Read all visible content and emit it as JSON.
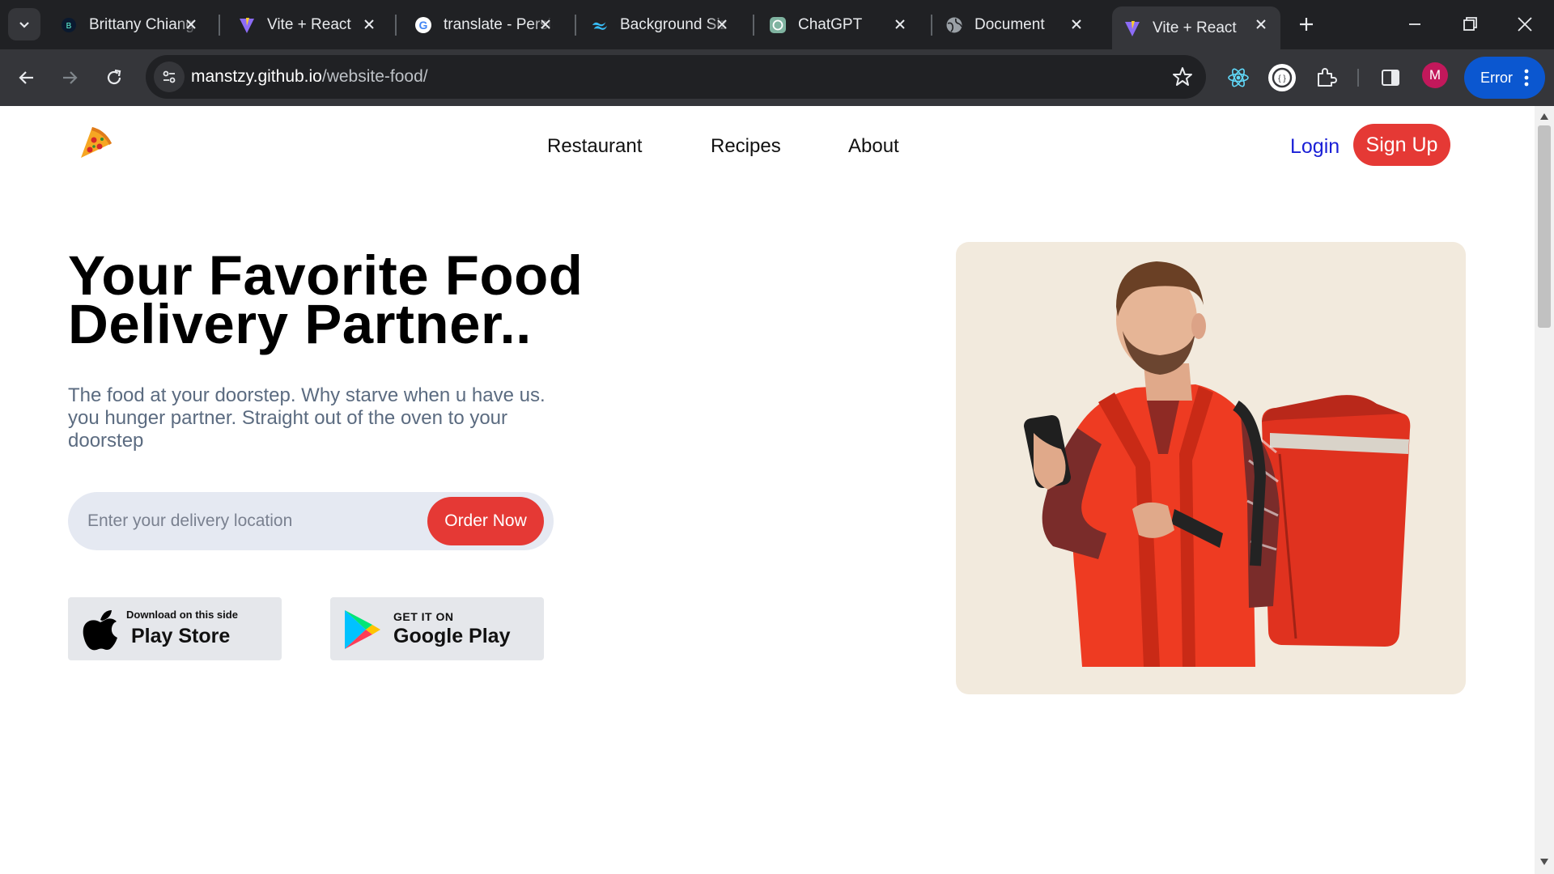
{
  "browser": {
    "tabs": [
      {
        "label": "Brittany Chiang",
        "icon": "b-favicon"
      },
      {
        "label": "Vite + React",
        "icon": "vite-icon"
      },
      {
        "label": "translate - Persian",
        "icon": "google-icon"
      },
      {
        "label": "Background Size",
        "icon": "tailwind-icon"
      },
      {
        "label": "ChatGPT",
        "icon": "chatgpt-icon"
      },
      {
        "label": "Document",
        "icon": "globe-icon"
      },
      {
        "label": "Vite + React",
        "icon": "vite-icon",
        "active": true
      }
    ],
    "url_host": "manstzy.github.io",
    "url_path": "/website-food/",
    "profile_initial": "M",
    "error_label": "Error"
  },
  "page": {
    "nav": {
      "links": [
        "Restaurant",
        "Recipes",
        "About"
      ],
      "login": "Login",
      "signup": "Sign Up"
    },
    "hero": {
      "headline_line1": "Your Favorite Food",
      "headline_line2": "Delivery Partner..",
      "subtext_line1": "The food at your doorstep. Why starve when u have us.",
      "subtext_line2": "you hunger partner. Straight out of the oven to your",
      "subtext_line3": "doorstep",
      "search_placeholder": "Enter your delivery location",
      "order_label": "Order Now"
    },
    "stores": {
      "apple_small": "Download on this side",
      "apple_big": "Play Store",
      "google_small": "GET IT ON",
      "google_big": "Google Play"
    }
  },
  "colors": {
    "accent": "#e53935",
    "login": "#1a1fd6",
    "card_bg": "#f2eadd",
    "search_bg": "#e5e9f2"
  }
}
